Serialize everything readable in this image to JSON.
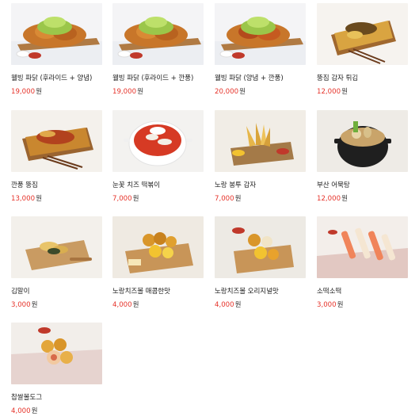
{
  "currency_unit": "원",
  "colors": {
    "price": "#e6332a",
    "name": "#222222"
  },
  "products": [
    {
      "name": "웰빙 파닭 (후라이드 + 양념)",
      "price": "19,000",
      "image": "fried-chicken-platter"
    },
    {
      "name": "웰빙 파닭 (후라이드 + 깐풍)",
      "price": "19,000",
      "image": "fried-chicken-platter"
    },
    {
      "name": "웰빙 파닭 (양념 + 깐풍)",
      "price": "20,000",
      "image": "fried-chicken-platter"
    },
    {
      "name": "뚱짐 감자 튀김",
      "price": "12,000",
      "image": "potato-fries-box"
    },
    {
      "name": "깐풍 뚱짐",
      "price": "13,000",
      "image": "spicy-fries-box"
    },
    {
      "name": "눈꽃 치즈 떡볶이",
      "price": "7,000",
      "image": "tteokbokki-bowl"
    },
    {
      "name": "노랑 봉투 감자",
      "price": "7,000",
      "image": "potato-wedges-board"
    },
    {
      "name": "부산 어묵탕",
      "price": "12,000",
      "image": "fishcake-soup-pot"
    },
    {
      "name": "김말이",
      "price": "3,000",
      "image": "gimmari-board"
    },
    {
      "name": "노랑치즈볼 매콤한맛",
      "price": "4,000",
      "image": "cheeseball-spicy"
    },
    {
      "name": "노랑치즈볼 오리지널맛",
      "price": "4,000",
      "image": "cheeseball-original"
    },
    {
      "name": "소떡소떡",
      "price": "3,000",
      "image": "sotteok-skewers"
    },
    {
      "name": "찹쌀볼도그",
      "price": "4,000",
      "image": "rice-ball-dog"
    }
  ]
}
